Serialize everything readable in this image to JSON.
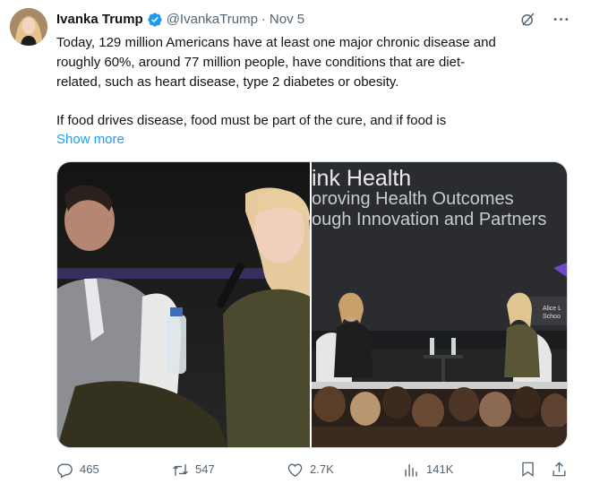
{
  "tweet": {
    "author": {
      "name": "Ivanka Trump",
      "handle": "@IvankaTrump",
      "separator": "·",
      "date": "Nov 5",
      "verified": true
    },
    "text_lines": [
      "Today, 129 million Americans have at least one major chronic disease and",
      "roughly 60%, around 77 million people, have conditions that are diet-",
      "related, such as heart disease, type 2 diabetes or obesity."
    ],
    "text_line_2": "If food drives disease, food must be part of the cure, and if food is",
    "show_more": "Show more",
    "media": {
      "right_photo_text": {
        "line1": "ink Health",
        "line2": "oroving Health Outcomes",
        "line3": "ough Innovation and Partners",
        "logo_text_1": "Alice L",
        "logo_text_2": "Schoo"
      }
    },
    "actions": {
      "replies": "465",
      "retweets": "547",
      "likes": "2.7K",
      "views": "141K"
    },
    "icons": {
      "verified": "verified-badge-icon",
      "grok": "grok-icon",
      "more": "more-icon",
      "reply": "reply-icon",
      "retweet": "retweet-icon",
      "like": "heart-icon",
      "views": "views-icon",
      "bookmark": "bookmark-icon",
      "share": "share-icon"
    },
    "colors": {
      "accent": "#1d9bf0",
      "muted": "#536471",
      "text": "#0f1419"
    }
  }
}
